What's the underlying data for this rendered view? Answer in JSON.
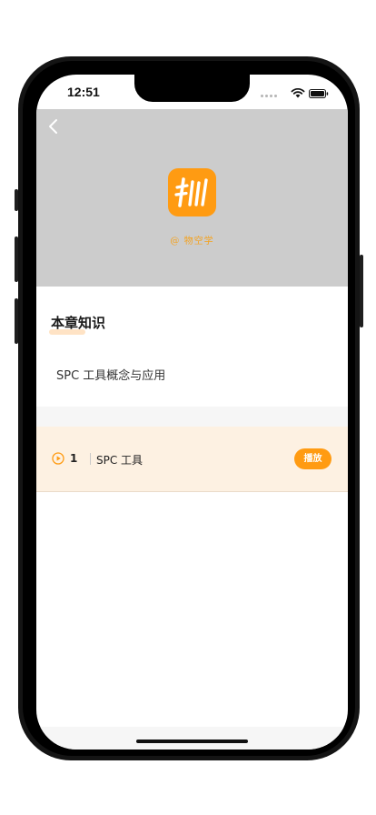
{
  "status_bar": {
    "time": "12:51",
    "icons": [
      "cellular-dots-icon",
      "wifi-icon",
      "battery-icon"
    ]
  },
  "header": {
    "back_icon": "chevron-left-icon",
    "logo_icon": "app-logo-icon",
    "brand": "@ 物空学",
    "background": "#cccccc"
  },
  "section": {
    "title": "本章知识",
    "topic": "SPC 工具概念与应用"
  },
  "lessons": [
    {
      "number": "1",
      "title": "SPC 工具",
      "icon": "play-circle-icon",
      "action_label": "播放"
    }
  ],
  "colors": {
    "accent": "#ff9b12",
    "row_background": "#fdf1e2",
    "brand_text": "#f4a21f"
  }
}
